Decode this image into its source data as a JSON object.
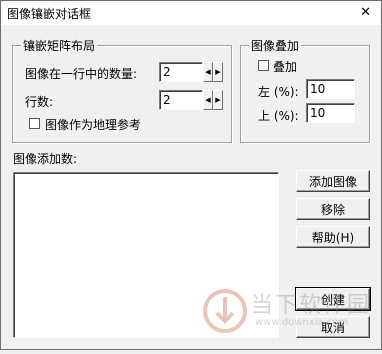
{
  "window": {
    "title": "图像镶嵌对话框",
    "close": "✕"
  },
  "layout_group": {
    "legend": "镶嵌矩阵布局",
    "per_row_label": "图像在一行中的数量:",
    "per_row_value": "2",
    "rows_label": "行数:",
    "rows_value": "2",
    "georef_label": "图像作为地理参考"
  },
  "overlay_group": {
    "legend": "图像叠加",
    "overlay_label": "叠加",
    "left_label": "左 (%):",
    "left_value": "10",
    "top_label": "上 (%):",
    "top_value": "10"
  },
  "list": {
    "label": "图像添加数:"
  },
  "buttons": {
    "add": "添加图像",
    "remove": "移除",
    "help": "帮助(H)",
    "create": "创建",
    "cancel": "取消"
  },
  "watermark": {
    "text": "当下软件园",
    "url": "www.downxia.com"
  },
  "icons": {
    "spin_left": "◀",
    "spin_right": "▶"
  }
}
